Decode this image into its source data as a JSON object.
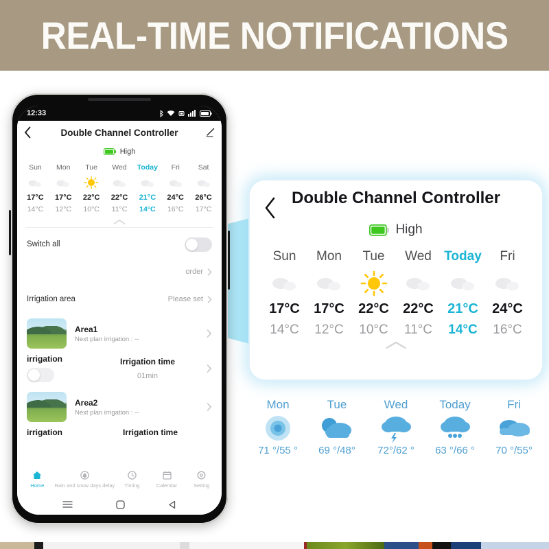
{
  "banner": {
    "title": "REAL-TIME NOTIFICATIONS",
    "bg": "#a79982",
    "text_color": "#fbfaf6"
  },
  "accent": {
    "cyan": "#1ab4d4",
    "blue": "#4f9fd0",
    "battery_green": "#3ec820"
  },
  "phone": {
    "statusbar": {
      "time": "12:33",
      "icons": [
        "bluetooth-icon",
        "wifi-icon",
        "vibrate-icon",
        "signal-icon",
        "battery-icon"
      ]
    },
    "header": {
      "title": "Double Channel Controller",
      "back_icon": "chevron-left-icon",
      "edit_icon": "pencil-icon"
    },
    "battery": {
      "label": "High",
      "icon": "battery-full-icon"
    },
    "forecast": {
      "days": [
        "Sun",
        "Mon",
        "Tue",
        "Wed",
        "Today",
        "Fri",
        "Sat"
      ],
      "today_index": 4,
      "icons": [
        "cloudy-icon",
        "cloudy-icon",
        "sunny-icon",
        "cloudy-icon",
        "cloudy-icon",
        "cloudy-icon",
        "cloudy-icon"
      ],
      "highs": [
        "17°C",
        "17°C",
        "22°C",
        "22°C",
        "21°C",
        "24°C",
        "26°C"
      ],
      "lows": [
        "14°C",
        "12°C",
        "10°C",
        "11°C",
        "14°C",
        "16°C",
        "17°C"
      ],
      "collapse_icon": "chevron-up-icon"
    },
    "rows": {
      "switch_all_label": "Switch all",
      "order_label": "order",
      "irrigation_area_label": "Irrigation area",
      "irrigation_area_value": "Please set"
    },
    "areas": [
      {
        "name": "Area1",
        "sub": "Next plan irrigation : --",
        "irrigation_label": "irrigation",
        "time_label": "Irrigation time",
        "time_value": "01min"
      },
      {
        "name": "Area2",
        "sub": "Next plan irrigation : --",
        "irrigation_label": "irrigation",
        "time_label": "Irrigation time",
        "time_value": ""
      }
    ],
    "tabs": [
      {
        "label": "Home",
        "icon": "home-icon",
        "active": true
      },
      {
        "label": "Rain and snow days delay",
        "icon": "raindrop-icon",
        "active": false
      },
      {
        "label": "Timing",
        "icon": "clock-icon",
        "active": false
      },
      {
        "label": "Calendar",
        "icon": "calendar-icon",
        "active": false
      },
      {
        "label": "Setting",
        "icon": "gear-icon",
        "active": false
      }
    ],
    "navbar": [
      "menu-icon",
      "home-square-icon",
      "back-triangle-icon"
    ]
  },
  "zoom_card": {
    "title": "Double Channel Controller",
    "back_icon": "chevron-left-icon",
    "battery": {
      "label": "High",
      "icon": "battery-full-icon"
    },
    "days": [
      "Sun",
      "Mon",
      "Tue",
      "Wed",
      "Today",
      "Fri"
    ],
    "today_index": 4,
    "icons": [
      "cloudy-icon",
      "cloudy-icon",
      "sunny-icon",
      "cloudy-icon",
      "cloudy-icon",
      "cloudy-icon"
    ],
    "highs": [
      "17°C",
      "17°C",
      "22°C",
      "22°C",
      "21°C",
      "24°C"
    ],
    "lows": [
      "14°C",
      "12°C",
      "10°C",
      "11°C",
      "14°C",
      "16°C"
    ],
    "collapse_icon": "chevron-up-icon"
  },
  "weather_strip": [
    {
      "day": "Mon",
      "icon": "sunny-icon",
      "temp": "71 °/55 °"
    },
    {
      "day": "Tue",
      "icon": "partly-cloudy-icon",
      "temp": "69 °/48°"
    },
    {
      "day": "Wed",
      "icon": "thunderstorm-icon",
      "temp": "72°/62 °"
    },
    {
      "day": "Today",
      "icon": "rain-icon",
      "temp": "63 °/66 °"
    },
    {
      "day": "Fri",
      "icon": "cloudy-icon",
      "temp": "70 °/55°"
    }
  ]
}
